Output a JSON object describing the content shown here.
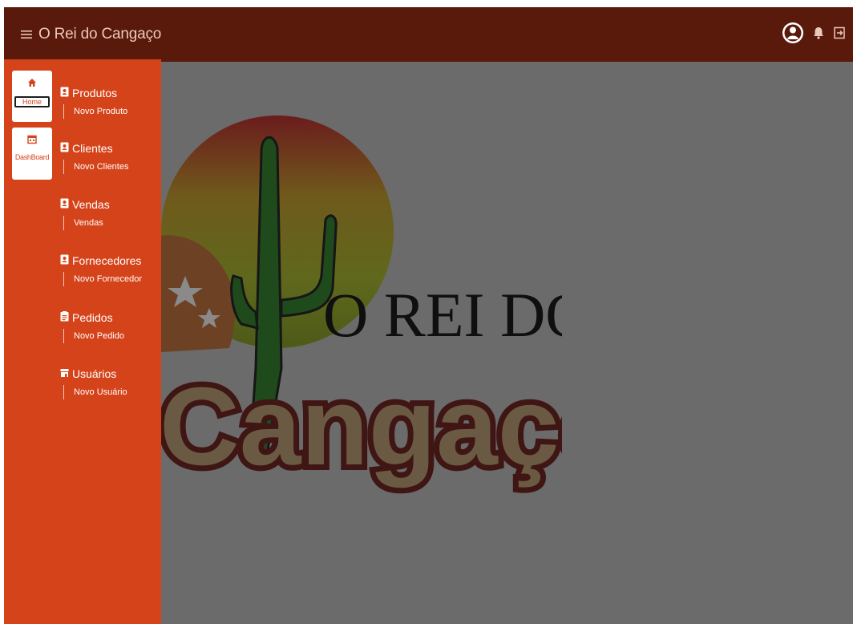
{
  "app": {
    "title": "O Rei do Cangaço"
  },
  "header": {
    "menu_icon": "hamburger-icon",
    "icons": [
      "account-circle-icon",
      "bell-icon",
      "logout-icon"
    ]
  },
  "quick_tiles": [
    {
      "label": "Home",
      "icon": "home-icon"
    },
    {
      "label": "DashBoard",
      "icon": "dashboard-icon"
    }
  ],
  "nav": {
    "sections": [
      {
        "label": "Produtos",
        "sub": "Novo Produto",
        "icon": "contact-book-icon"
      },
      {
        "label": "Clientes",
        "sub": "Novo Clientes",
        "icon": "contact-book-icon"
      },
      {
        "label": "Vendas",
        "sub": "Vendas",
        "icon": "contact-book-icon"
      },
      {
        "label": "Fornecedores",
        "sub": "Novo Fornecedor",
        "icon": "contact-book-icon"
      },
      {
        "label": "Pedidos",
        "sub": "Novo Pedido",
        "icon": "clipboard-icon"
      },
      {
        "label": "Usuários",
        "sub": "Novo Usuário",
        "icon": "store-icon"
      }
    ]
  },
  "logo": {
    "line1": "O REI DO",
    "line2": "Cangaço"
  },
  "colors": {
    "topbar": "#5a1a0b",
    "sidebar": "#d5431a",
    "overlay": "#6b6b6b",
    "tile": "#ffffff"
  }
}
